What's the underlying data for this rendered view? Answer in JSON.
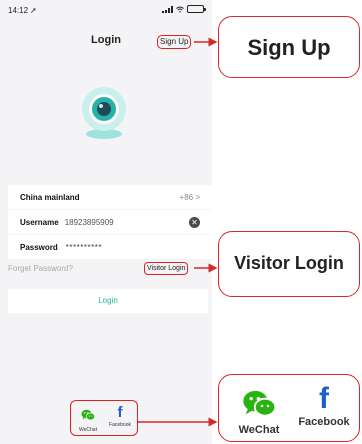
{
  "status_bar": {
    "time": "14:12",
    "location_icon": "location-arrow-icon",
    "signal_icon": "signal-icon",
    "wifi_icon": "wifi-icon",
    "battery_icon": "battery-icon"
  },
  "header": {
    "title": "Login",
    "signup_label": "Sign Up"
  },
  "logo": {
    "icon": "camera-icon"
  },
  "form": {
    "region_label": "China mainland",
    "region_code": "+86 >",
    "username_label": "Username",
    "username_value": "18923895909",
    "clear_icon": "clear-icon",
    "password_label": "Password",
    "password_value": "**********"
  },
  "links": {
    "forgot_password": "Forget Password?",
    "visitor_login": "Visitor Login"
  },
  "login_button": "Login",
  "social": {
    "wechat_label": "WeChat",
    "facebook_label": "Facebook",
    "facebook_glyph": "f"
  },
  "callouts": {
    "signup": "Sign Up",
    "visitor": "Visitor Login",
    "wechat": "WeChat",
    "facebook": "Facebook",
    "facebook_glyph": "f"
  },
  "colors": {
    "accent": "#2ab3a6",
    "highlight": "#e02020",
    "wechat_green": "#28b30f",
    "facebook_blue": "#1a5fd0"
  }
}
